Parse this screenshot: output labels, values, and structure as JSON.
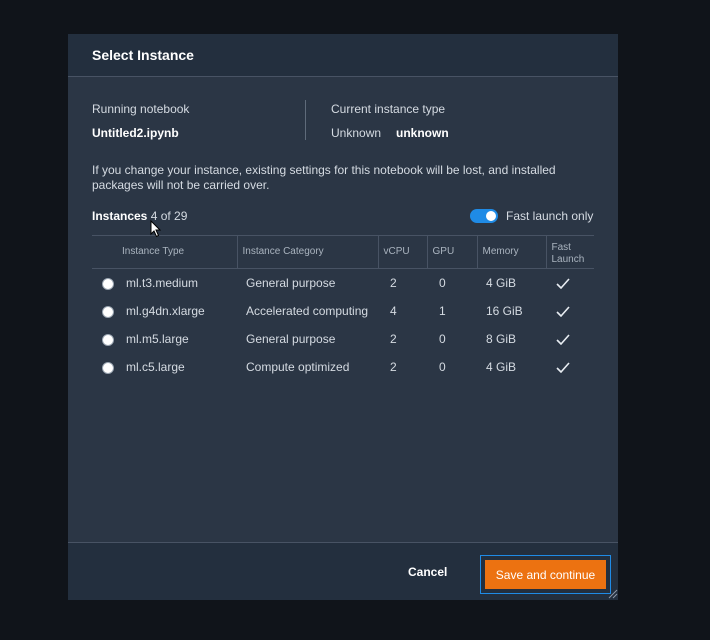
{
  "dialog": {
    "title": "Select Instance",
    "running_notebook_label": "Running notebook",
    "running_notebook_value": "Untitled2.ipynb",
    "current_type_label": "Current instance type",
    "current_type_unknown_label": "Unknown",
    "current_type_value": "unknown",
    "warning": "If you change your instance, existing settings for this notebook will be lost, and installed packages will not be carried over."
  },
  "instances": {
    "label": "Instances",
    "count": "4 of 29",
    "fast_launch_label": "Fast launch only",
    "fast_launch_on": true
  },
  "table": {
    "headers": [
      "Instance Type",
      "Instance Category",
      "vCPU",
      "GPU",
      "Memory",
      "Fast Launch"
    ],
    "rows": [
      {
        "type": "ml.t3.medium",
        "category": "General purpose",
        "vcpu": "2",
        "gpu": "0",
        "memory": "4 GiB",
        "fast_launch": true
      },
      {
        "type": "ml.g4dn.xlarge",
        "category": "Accelerated computing",
        "vcpu": "4",
        "gpu": "1",
        "memory": "16 GiB",
        "fast_launch": true
      },
      {
        "type": "ml.m5.large",
        "category": "General purpose",
        "vcpu": "2",
        "gpu": "0",
        "memory": "8 GiB",
        "fast_launch": true
      },
      {
        "type": "ml.c5.large",
        "category": "Compute optimized",
        "vcpu": "2",
        "gpu": "0",
        "memory": "4 GiB",
        "fast_launch": true
      }
    ]
  },
  "footer": {
    "cancel_label": "Cancel",
    "save_label": "Save and continue"
  },
  "colors": {
    "accent": "#1f8be6",
    "primary_button": "#ec7211"
  }
}
